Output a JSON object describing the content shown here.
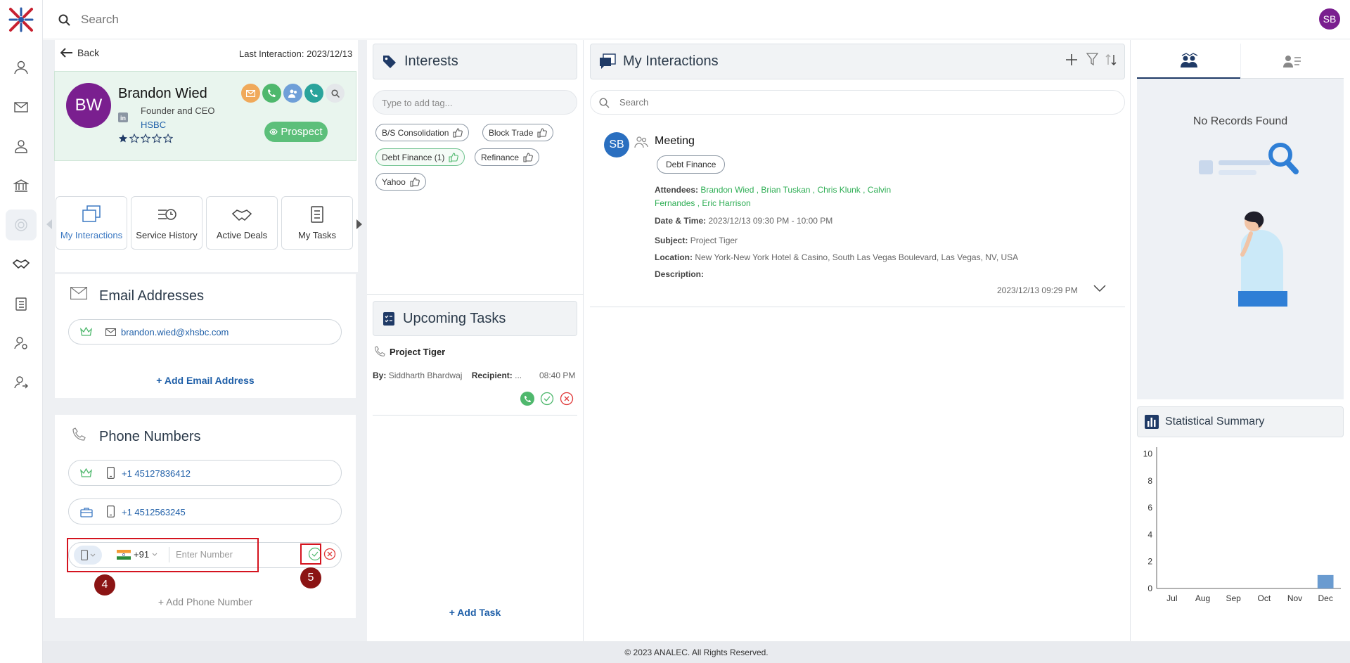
{
  "top": {
    "search_placeholder": "Search",
    "user_initials": "SB"
  },
  "profile": {
    "back_label": "Back",
    "last_interaction": "Last Interaction: 2023/12/13",
    "initials": "BW",
    "name": "Brandon Wied",
    "title": "Founder and CEO",
    "company": "HSBC",
    "status": "Prospect",
    "tiles": [
      {
        "label": "My Interactions",
        "icon": "interactions-icon"
      },
      {
        "label": "Service History",
        "icon": "service-history-icon"
      },
      {
        "label": "Active Deals",
        "icon": "handshake-icon"
      },
      {
        "label": "My Tasks",
        "icon": "clipboard-icon"
      }
    ]
  },
  "emails": {
    "title": "Email Addresses",
    "items": [
      "brandon.wied@xhsbc.com"
    ],
    "add_label": "+ Add Email Address"
  },
  "phones": {
    "title": "Phone Numbers",
    "items": [
      "+1 45127836412",
      "+1 4512563245"
    ],
    "country_code": "+91",
    "number_placeholder": "Enter Number",
    "add_label": "+ Add Phone Number",
    "step_badges": [
      "4",
      "5"
    ]
  },
  "interests": {
    "title": "Interests",
    "input_placeholder": "Type to add tag...",
    "tags": [
      "B/S Consolidation",
      "Block Trade",
      "Debt Finance (1)",
      "Refinance",
      "Yahoo"
    ]
  },
  "tasks": {
    "title": "Upcoming Tasks",
    "task_title": "Project Tiger",
    "by_label": "By:",
    "by_value": "Siddharth Bhardwaj",
    "recipient_label": "Recipient:",
    "recipient_value": "...",
    "time": "08:40 PM",
    "add_label": "+ Add Task"
  },
  "interactions": {
    "title": "My Interactions",
    "search_placeholder": "Search",
    "item": {
      "initials": "SB",
      "type": "Meeting",
      "tag": "Debt Finance",
      "attendees_label": "Attendees:",
      "attendees_line1": "Brandon Wied , Brian Tuskan , Chris Klunk , Calvin",
      "attendees_line2": "Fernandes , Eric Harrison",
      "datetime_label": "Date & Time:",
      "datetime_value": "2023/12/13 09:30 PM - 10:00 PM",
      "subject_label": "Subject:",
      "subject_value": "Project Tiger",
      "location_label": "Location:",
      "location_value": "New York-New York Hotel & Casino, South Las Vegas Boulevard, Las Vegas, NV, USA",
      "description_label": "Description:",
      "timestamp": "2023/12/13 09:29 PM"
    }
  },
  "right": {
    "no_records": "No Records Found",
    "stats_title": "Statistical Summary"
  },
  "chart_data": {
    "type": "bar",
    "categories": [
      "Jul",
      "Aug",
      "Sep",
      "Oct",
      "Nov",
      "Dec"
    ],
    "values": [
      0,
      0,
      0,
      0,
      0,
      1
    ],
    "yticks": [
      0,
      2,
      4,
      6,
      8,
      10
    ],
    "ylim": [
      0,
      10.5
    ],
    "color": "#6a9bd0"
  },
  "footer": {
    "copyright": "© 2023 ANALEC. All Rights Reserved."
  },
  "colors": {
    "accent": "#1f5fa8",
    "brand_purple": "#7a1f8f",
    "prospect_green": "#5cbf7a",
    "badge_red": "#8b1414"
  }
}
